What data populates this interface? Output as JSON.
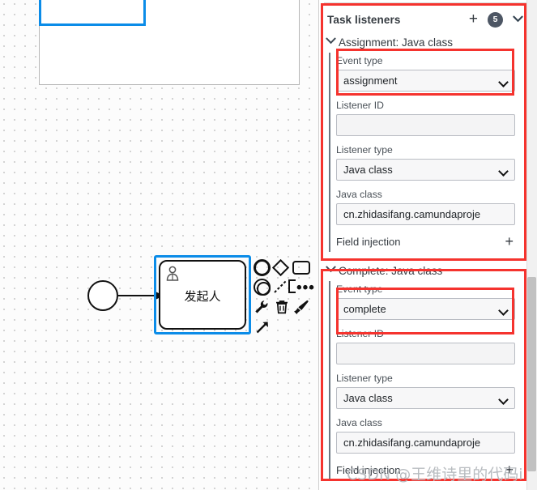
{
  "canvas": {
    "start_event_name": "start-event",
    "task": {
      "label": "发起人",
      "marker": "user-task-icon"
    },
    "context_pad": [
      {
        "name": "append-end-event",
        "glyph": ""
      },
      {
        "name": "append-gateway",
        "glyph": ""
      },
      {
        "name": "append-task",
        "glyph": ""
      },
      {
        "name": "append-intermediate-event",
        "glyph": ""
      },
      {
        "name": "connect-tool",
        "glyph": ""
      },
      {
        "name": "append-subprocess",
        "glyph": ""
      },
      {
        "name": "more-options",
        "glyph": "•••"
      },
      {
        "name": "change-type-wrench",
        "glyph": "⚒"
      },
      {
        "name": "delete-trash",
        "glyph": "Ὕ1"
      },
      {
        "name": "set-color-brush",
        "glyph": "὘C"
      },
      {
        "name": "connect-arrow",
        "glyph": "↗"
      }
    ]
  },
  "panel": {
    "header": {
      "title": "Task listeners",
      "add_label": "+",
      "count": "5",
      "collapse_glyph": "❯"
    },
    "listeners": [
      {
        "title": "Assignment: Java class",
        "chevron": "❯",
        "event_type_label": "Event type",
        "event_type_value": "assignment",
        "listener_id_label": "Listener ID",
        "listener_id_value": "",
        "listener_type_label": "Listener type",
        "listener_type_value": "Java class",
        "java_class_label": "Java class",
        "java_class_value": "cn.zhidasifang.camundaproje",
        "field_injection_label": "Field injection",
        "field_injection_add": "+"
      },
      {
        "title": "Complete: Java class",
        "chevron": "❯",
        "event_type_label": "Event type",
        "event_type_value": "complete",
        "listener_id_label": "Listener ID",
        "listener_id_value": "",
        "listener_type_label": "Listener type",
        "listener_type_value": "Java class",
        "java_class_label": "Java class",
        "java_class_value": "cn.zhidasifang.camundaproje",
        "field_injection_label": "Field injection",
        "field_injection_add": "+"
      }
    ]
  },
  "watermark": {
    "text": "CSDN @王维诗里的代码i"
  },
  "colors": {
    "annotation": "#f5332e",
    "selection": "#0b8ce8",
    "badge": "#4d5664",
    "panel_bg": "#ffffff",
    "canvas_bg": "#fcfcfc"
  }
}
